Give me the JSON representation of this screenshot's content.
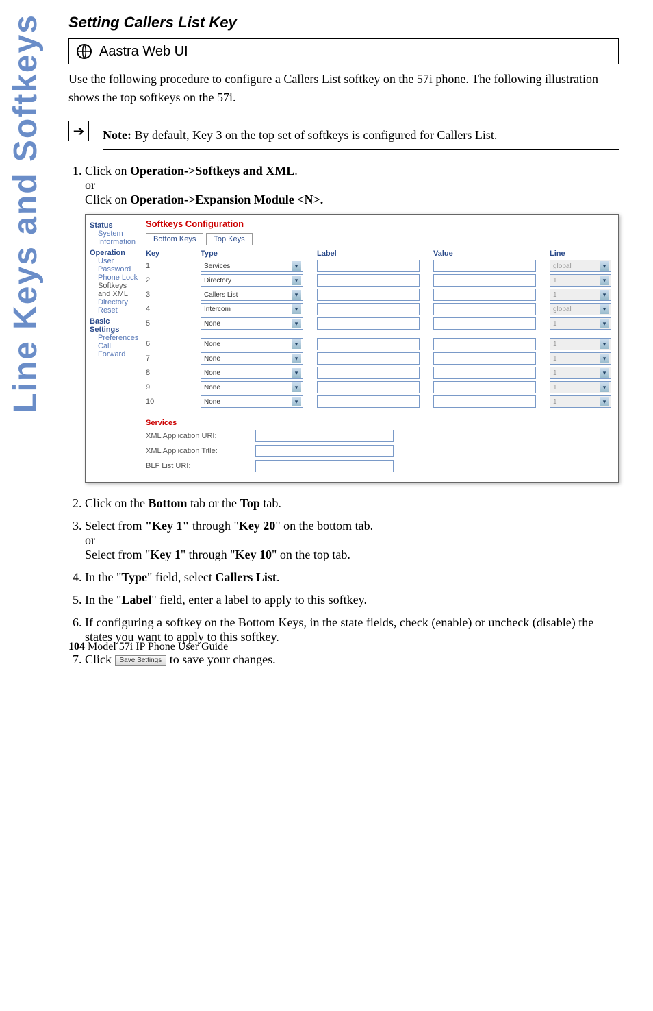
{
  "side_title": "Line Keys and Softkeys",
  "heading": "Setting Callers List Key",
  "webui_label": "Aastra Web UI",
  "intro": "Use the following procedure to configure a Callers List softkey on the 57i phone. The following illustration shows the top softkeys on the 57i.",
  "note_label": "Note:",
  "note_text": " By default, Key 3 on the top set of softkeys is configured for Callers List.",
  "step1_a": "Click on ",
  "step1_b": "Operation->Softkeys and XML",
  "step1_or": "or",
  "step1_c": "Click on ",
  "step1_d": "Operation->Expansion Module <N>.",
  "step2_a": "Click on the ",
  "step2_b": "Bottom",
  "step2_c": " tab or the ",
  "step2_d": "Top",
  "step2_e": " tab.",
  "step3_a": "Select from ",
  "step3_b": "\"Key 1\"",
  "step3_c": " through \"",
  "step3_d": "Key 20",
  "step3_e": "\" on the bottom tab.",
  "step3_or": "or",
  "step3_f": "Select from \"",
  "step3_g": "Key 1",
  "step3_h": "\" through \"",
  "step3_i": "Key 10",
  "step3_j": "\" on the top tab.",
  "step4_a": "In the \"",
  "step4_b": "Type",
  "step4_c": "\" field, select ",
  "step4_d": "Callers List",
  "step4_e": ".",
  "step5_a": "In the \"",
  "step5_b": "Label",
  "step5_c": "\" field, enter a label to apply to this softkey.",
  "step6": "If configuring a softkey on the Bottom Keys, in the state fields, check (enable) or uncheck (disable) the states you want to apply to this softkey.",
  "step7_a": "Click ",
  "step7_b": "Save Settings",
  "step7_c": " to save your changes.",
  "shot": {
    "nav": {
      "status": "Status",
      "sysinfo": "System Information",
      "operation": "Operation",
      "userpw": "User Password",
      "phonelock": "Phone Lock",
      "softxml": "Softkeys and XML",
      "directory": "Directory",
      "reset": "Reset",
      "basic": "Basic Settings",
      "prefs": "Preferences",
      "callfwd": "Call Forward"
    },
    "title": "Softkeys Configuration",
    "tab_bottom": "Bottom Keys",
    "tab_top": "Top Keys",
    "cols": {
      "key": "Key",
      "type": "Type",
      "label": "Label",
      "value": "Value",
      "line": "Line"
    },
    "rows": [
      {
        "n": "1",
        "type": "Services",
        "line": "global",
        "linedis": true
      },
      {
        "n": "2",
        "type": "Directory",
        "line": "1",
        "linedis": true
      },
      {
        "n": "3",
        "type": "Callers List",
        "line": "1",
        "linedis": true
      },
      {
        "n": "4",
        "type": "Intercom",
        "line": "global",
        "linedis": true
      },
      {
        "n": "5",
        "type": "None",
        "line": "1",
        "linedis": true
      },
      {
        "n": "6",
        "type": "None",
        "line": "1",
        "linedis": true
      },
      {
        "n": "7",
        "type": "None",
        "line": "1",
        "linedis": true
      },
      {
        "n": "8",
        "type": "None",
        "line": "1",
        "linedis": true
      },
      {
        "n": "9",
        "type": "None",
        "line": "1",
        "linedis": true
      },
      {
        "n": "10",
        "type": "None",
        "line": "1",
        "linedis": true
      }
    ],
    "services": "Services",
    "xmlapp": "XML Application URI:",
    "xmltitle": "XML Application Title:",
    "blf": "BLF List URI:"
  },
  "footer_num": "104",
  "footer_txt": "  Model 57i IP Phone User Guide"
}
